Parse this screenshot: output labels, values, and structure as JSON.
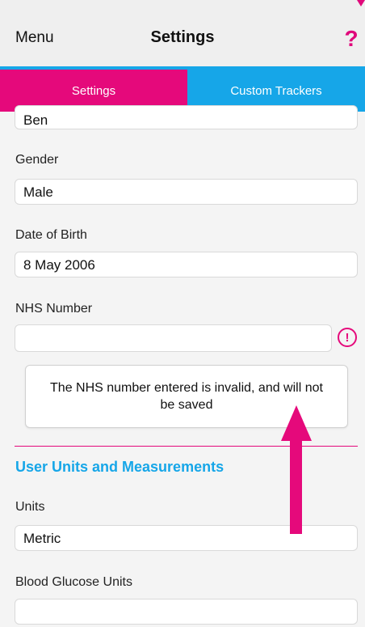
{
  "header": {
    "menu_label": "Menu",
    "title": "Settings",
    "help_symbol": "?"
  },
  "tabs": [
    {
      "label": "Settings",
      "active": true,
      "color": "#e5097b"
    },
    {
      "label": "Custom Trackers",
      "active": false,
      "color": "#16a6e8"
    }
  ],
  "form": {
    "name_value": "Ben",
    "gender": {
      "label": "Gender",
      "value": "Male"
    },
    "dob": {
      "label": "Date of Birth",
      "value": "8 May 2006"
    },
    "nhs": {
      "label": "NHS Number",
      "value": "",
      "alert_symbol": "!"
    },
    "error_message": "The NHS number entered is invalid, and will not be saved",
    "section_title": "User Units and Measurements",
    "units": {
      "label": "Units",
      "value": "Metric"
    },
    "glucose_units": {
      "label": "Blood Glucose Units",
      "value": ""
    }
  },
  "colors": {
    "accent_pink": "#e5097b",
    "accent_blue": "#16a6e8"
  },
  "icons": {
    "help": "question-mark-icon",
    "alert": "exclamation-circle-icon",
    "annotation": "arrow-up-icon"
  }
}
